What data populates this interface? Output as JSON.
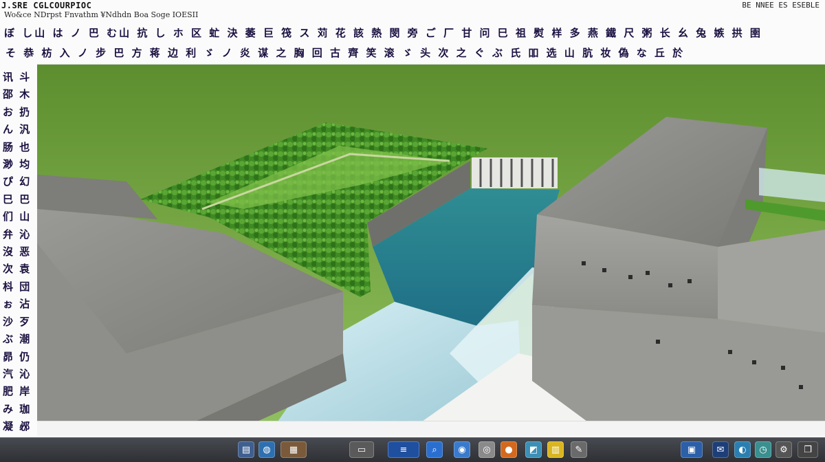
{
  "window": {
    "title": "J.SRE CGLCOURPIOC",
    "subtitle": "Wo&ce  NDrpst  Fnvathm  ¥Ndhdn  Boa  Soge IOESII",
    "corner_label": "BE  NNEE  ES  ESEBLE"
  },
  "toolbar": {
    "row1": "ぼ し山 は ノ 巴 む山 抗 し ホ 区 虻 決 萎 巨 筏 ス 苅 花 該 熱 閔 旁 ご 厂 甘 问 巳 祖 熨 样 多 燕 鐵 尺 粥 长 幺 兔 嫉 拱 圉",
    "row2": "そ 恭 枋 入 ノ 步 巴 方 蒋 边 利 ゞ ノ 炎 谋 之 胸 回 古 齊 笑 滚 ゞ 头 次 之 ぐ ぶ 氏 吅 选 山 肮 妆 偽 な 丘 於"
  },
  "left_rail": {
    "glyphs": "讯 斗\n邵 木\nお 扔\nん 汎\n肠 也\n渺 均\nぴ 幻\n巳 巴\n们 山\n弁 沁\n沒 恶\n次 袁\n枓 団\nぉ 沾\n沙 歹\nぶ 潮\n昴 仍\n汽 沁\n肥 岸\nみ 珈\n凝 邲"
  },
  "viewport": {
    "scene": "concrete-building-rooftop-garden-render",
    "colors": {
      "lake": "#6f9e3c",
      "pool": "#2e8a96",
      "concrete": "#8c8c88",
      "garden": "#3f8a22",
      "glass": "#bfe3ec"
    }
  },
  "taskbar": {
    "icons": [
      "terminal-icon",
      "globe-icon",
      "folder-icon",
      "monitor-icon",
      "network-icon",
      "search-icon",
      "chrome-icon",
      "disc-icon",
      "firefox-icon",
      "image-icon",
      "notes-icon",
      "tool-icon",
      "display-icon",
      "chat-icon",
      "mail-icon",
      "clock-icon",
      "settings-icon",
      "window-icon"
    ]
  }
}
